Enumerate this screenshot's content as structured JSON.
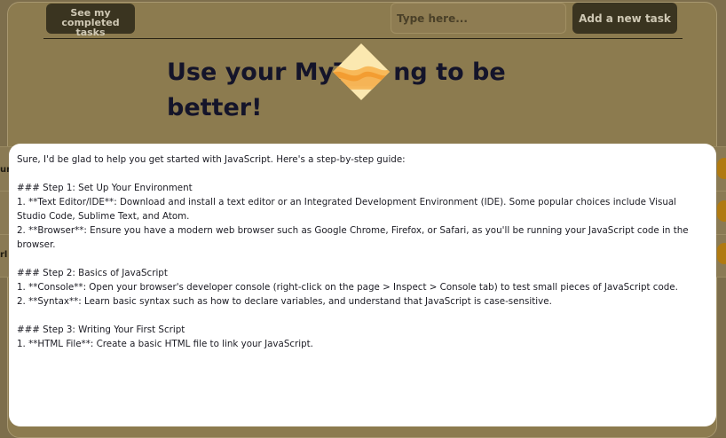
{
  "header": {
    "completed_label": "See my completed tasks",
    "input_placeholder": "Type here...",
    "add_label": "Add a new task"
  },
  "hero": {
    "title": "Use your MyT         ng to be better!"
  },
  "background_edges": {
    "row1": "ur",
    "row2": "rl"
  },
  "loader_icon": "diamond-wave-loader",
  "colors": {
    "accent": "#f29a2e",
    "dark_button": "#3a3420",
    "overlay": "#7d6e4c"
  },
  "message": {
    "text": "Sure, I'd be glad to help you get started with JavaScript. Here's a step-by-step guide:\n\n### Step 1: Set Up Your Environment\n1. **Text Editor/IDE**: Download and install a text editor or an Integrated Development Environment (IDE). Some popular choices include Visual Studio Code, Sublime Text, and Atom.\n2. **Browser**: Ensure you have a modern web browser such as Google Chrome, Firefox, or Safari, as you'll be running your JavaScript code in the browser.\n\n### Step 2: Basics of JavaScript\n1. **Console**: Open your browser's developer console (right-click on the page > Inspect > Console tab) to test small pieces of JavaScript code.\n2. **Syntax**: Learn basic syntax such as how to declare variables, and understand that JavaScript is case-sensitive.\n\n### Step 3: Writing Your First Script\n1. **HTML File**: Create a basic HTML file to link your JavaScript."
  }
}
